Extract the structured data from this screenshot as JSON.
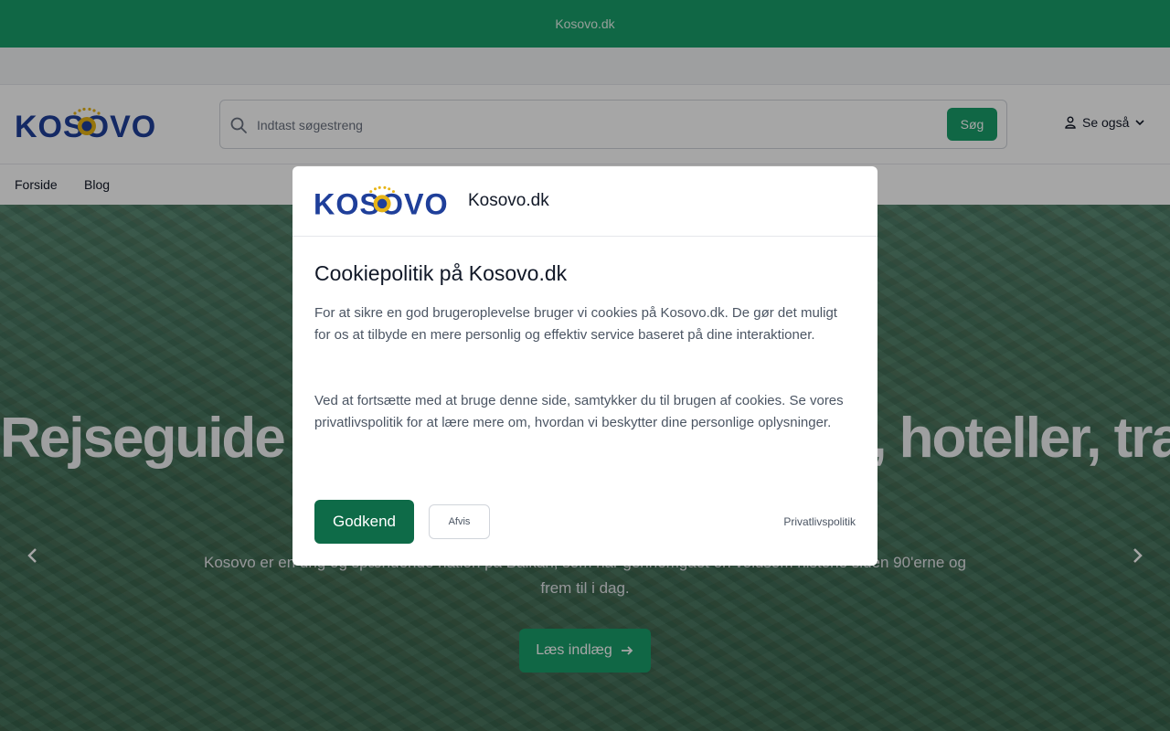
{
  "topbar": {
    "site_label": "Kosovo.dk"
  },
  "header": {
    "logo_text": "KOSOVO",
    "search": {
      "placeholder": "Indtast søgestreng",
      "button_label": "Søg"
    },
    "see_also_label": "Se også"
  },
  "nav": {
    "items": [
      "Forside",
      "Blog"
    ]
  },
  "hero": {
    "title": "Rejseguide til Kosovo: attraktioner, hoteller, transport",
    "text": "Kosovo er en ung og spændende nation på Balkan, som har gennemgået en voldsom historie siden 90'erne og frem til i dag.",
    "button_label": "Læs indlæg"
  },
  "cookie_modal": {
    "site_name": "Kosovo.dk",
    "title": "Cookiepolitik på Kosovo.dk",
    "paragraph_1": "For at sikre en god brugeroplevelse bruger vi cookies på Kosovo.dk. De gør det muligt for os at tilbyde en mere personlig og effektiv service baseret på dine interaktioner.",
    "paragraph_2": "Ved at fortsætte med at bruge denne side, samtykker du til brugen af cookies. Se vores privatlivspolitik for at lære mere om, hvordan vi beskytter dine personlige oplysninger.",
    "accept_label": "Godkend",
    "reject_label": "Afvis",
    "privacy_link": "Privatlivspolitik"
  },
  "colors": {
    "brand_green": "#1a9e6a",
    "accept_green": "#0e6b48",
    "logo_blue": "#1f3f9a",
    "logo_gold": "#e7b416"
  },
  "icons": [
    "search-icon",
    "user-icon",
    "chevron-down-icon",
    "arrow-right-icon",
    "chevron-left-icon",
    "chevron-right-icon"
  ]
}
